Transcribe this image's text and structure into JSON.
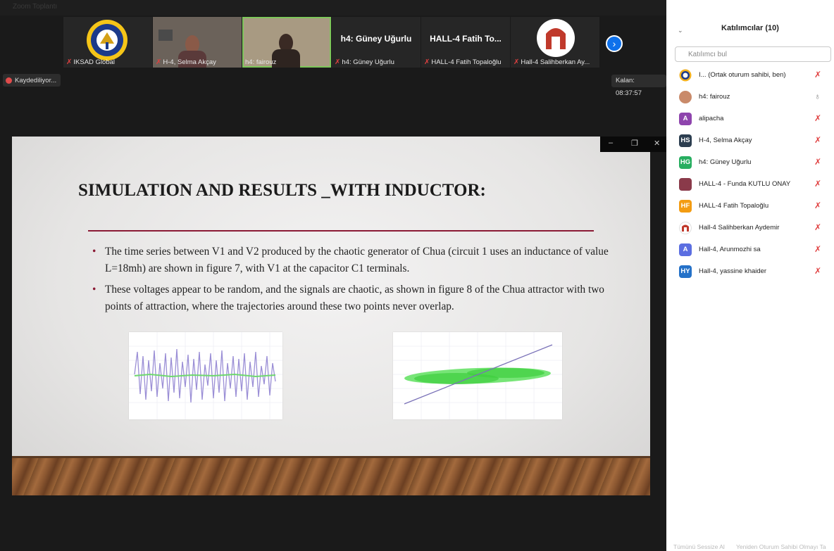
{
  "window": {
    "title": "Zoom Toplantı"
  },
  "thumbnails": [
    {
      "label": "IKSAD Global",
      "type": "logo"
    },
    {
      "label": "H-4, Selma Akçay",
      "type": "video"
    },
    {
      "label": "h4: fairouz",
      "type": "video"
    },
    {
      "label": "h4: Güney Uğurlu",
      "display": "h4: Güney Uğurlu",
      "type": "name"
    },
    {
      "label": "HALL-4 Fatih Topaloğlu",
      "display": "HALL-4 Fatih To...",
      "type": "name"
    },
    {
      "label": "Hall-4 Salihberkan Ay...",
      "type": "logo2"
    }
  ],
  "recording": {
    "label": "Kaydediliyor..."
  },
  "timer": {
    "label": "Kalan: 08:37:57"
  },
  "slide": {
    "title": "SIMULATION AND RESULTS _WITH INDUCTOR:",
    "bullets": [
      "The time series between V1 and V2 produced by the chaotic generator of Chua (circuit 1 uses an inductance of value L=18mh) are shown in figure 7, with V1 at the capacitor C1 terminals.",
      "These voltages appear to be random, and the signals are chaotic, as shown in figure 8 of the Chua attractor with two points of attraction, where the trajectories around these two points never overlap."
    ]
  },
  "participants_panel": {
    "title": "Katılımcılar (10)",
    "search_placeholder": "Katılımcı bul",
    "participants": [
      {
        "name": "I...  (Ortak oturum sahibi, ben)",
        "initials": "",
        "color": "#f2b01e"
      },
      {
        "name": "h4: fairouz",
        "initials": "",
        "color": "#c98a6a"
      },
      {
        "name": "alipacha",
        "initials": "A",
        "color": "#8e44ad"
      },
      {
        "name": "H-4, Selma Akçay",
        "initials": "HS",
        "color": "#2c3e50"
      },
      {
        "name": "h4: Güney Uğurlu",
        "initials": "HG",
        "color": "#27ae60"
      },
      {
        "name": "HALL-4 - Funda KUTLU ONAY",
        "initials": "",
        "color": "#8a3a4a"
      },
      {
        "name": "HALL-4 Fatih Topaloğlu",
        "initials": "HF",
        "color": "#f39c12"
      },
      {
        "name": "Hall-4 Salihberkan Aydemir",
        "initials": "",
        "color": "#c0392b"
      },
      {
        "name": "Hall-4, Arunmozhi sa",
        "initials": "A",
        "color": "#5b6ee1"
      },
      {
        "name": "Hall-4, yassine khaider",
        "initials": "HY",
        "color": "#2471c8"
      }
    ],
    "footer": [
      "Tümünü Sessize Al",
      "Yeniden Oturum Sahibi Olmayı Ta"
    ]
  }
}
